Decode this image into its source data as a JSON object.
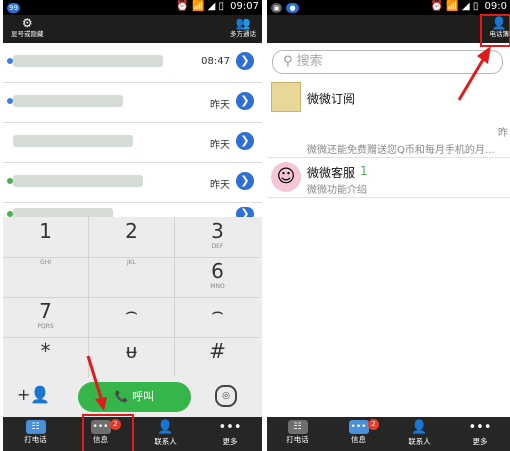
{
  "left_screen": {
    "status": {
      "badge": "99",
      "time": "09:07"
    },
    "topbar": {
      "hide_number_label": "显号或隐藏",
      "conference_label": "多方通话"
    },
    "call_log": [
      {
        "time": "08:47"
      },
      {
        "time": "昨天"
      },
      {
        "time": "昨天"
      },
      {
        "time": "昨天"
      },
      {
        "time": ""
      }
    ],
    "dialpad": [
      {
        "digit": "1",
        "letters": ""
      },
      {
        "digit": "2",
        "letters": ""
      },
      {
        "digit": "3",
        "letters": "DEF"
      },
      {
        "digit": "",
        "letters": "GHI"
      },
      {
        "digit": "",
        "letters": "JKL"
      },
      {
        "digit": "6",
        "letters": "MNO"
      },
      {
        "digit": "7",
        "letters": "PQRS"
      },
      {
        "digit": "⌢",
        "letters": ""
      },
      {
        "digit": "⌢",
        "letters": ""
      },
      {
        "digit": "*",
        "letters": ""
      },
      {
        "digit": "ᵾ",
        "letters": ""
      },
      {
        "digit": "#",
        "letters": ""
      }
    ],
    "call_bar": {
      "add_label": "+👤",
      "call_label": "📞 呼叫"
    },
    "bottom_nav": [
      {
        "label": "打电话",
        "icon": "dialer-icon"
      },
      {
        "label": "信息",
        "icon": "message-icon",
        "badge": "2"
      },
      {
        "label": "联系人",
        "icon": "contacts-icon"
      },
      {
        "label": "更多",
        "icon": "more-icon"
      }
    ]
  },
  "right_screen": {
    "status": {
      "time": "09:0"
    },
    "topbar": {
      "call_tab_label": "电话簿"
    },
    "search": {
      "placeholder": "搜索"
    },
    "conversations": [
      {
        "title": "微微订阅",
        "subtitle": ""
      },
      {
        "title": "",
        "subtitle": "微微还能免费赠送您Q币和每月手机的月…",
        "time": "昨"
      },
      {
        "title": "微微客服",
        "badge": "1",
        "subtitle": "微微功能介绍"
      }
    ],
    "bottom_nav": [
      {
        "label": "打电话",
        "icon": "dialer-icon"
      },
      {
        "label": "信息",
        "icon": "message-icon",
        "badge": "2"
      },
      {
        "label": "联系人",
        "icon": "contacts-icon"
      },
      {
        "label": "更多",
        "icon": "more-icon"
      }
    ]
  },
  "colors": {
    "accent_blue": "#2f6fd8",
    "call_green": "#35b54a",
    "highlight_red": "#e01b1b",
    "bar_dark": "#262626"
  }
}
